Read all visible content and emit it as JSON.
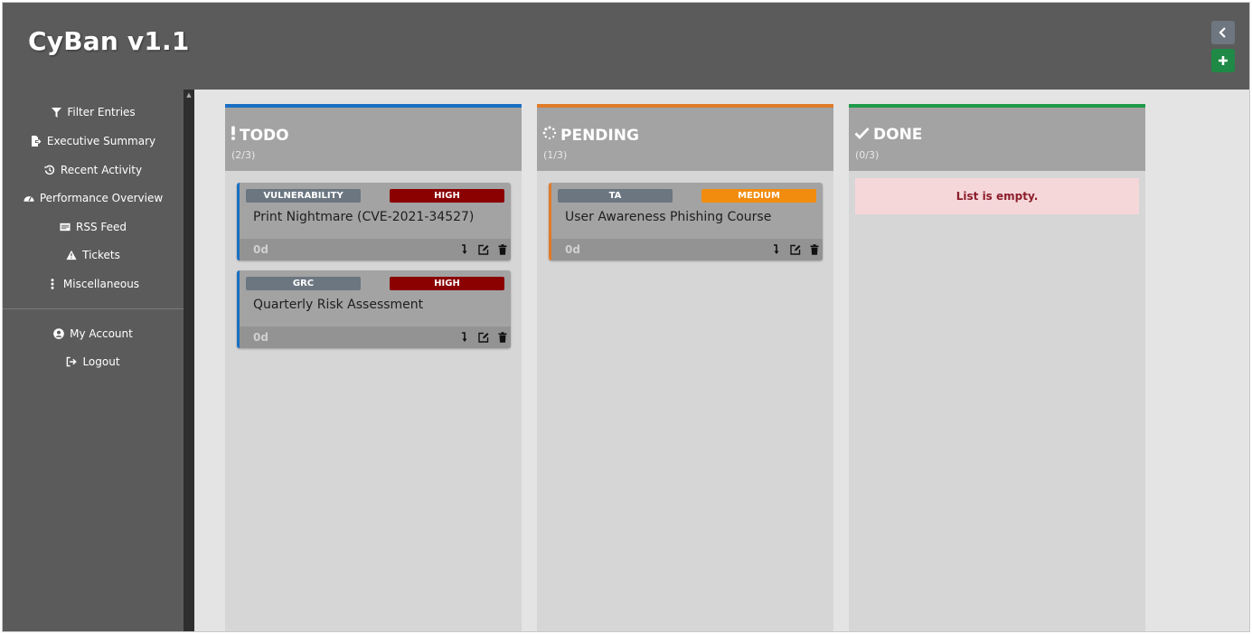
{
  "app": {
    "title": "CyBan v1.1"
  },
  "header_buttons": {
    "collapse": "‹",
    "add": "+"
  },
  "sidebar": {
    "items": [
      {
        "label": "Filter Entries",
        "icon": "filter-icon"
      },
      {
        "label": "Executive Summary",
        "icon": "export-file-icon"
      },
      {
        "label": "Recent Activity",
        "icon": "history-icon"
      },
      {
        "label": "Performance Overview",
        "icon": "tachometer-icon"
      },
      {
        "label": "RSS Feed",
        "icon": "newspaper-icon"
      },
      {
        "label": "Tickets",
        "icon": "warning-icon"
      },
      {
        "label": "Miscellaneous",
        "icon": "ellipsis-vertical-icon"
      }
    ],
    "account_items": [
      {
        "label": "My Account",
        "icon": "user-circle-icon"
      },
      {
        "label": "Logout",
        "icon": "sign-out-icon"
      }
    ]
  },
  "columns": [
    {
      "title": "TODO",
      "count": "(2/3)",
      "icon": "exclamation-icon",
      "accent": "#1a6fc4",
      "cards": [
        {
          "type": "VULNERABILITY",
          "priority": "HIGH",
          "priority_color": "#8b0000",
          "title": "Print Nightmare (CVE-2021-34527)",
          "age": "0d"
        },
        {
          "type": "GRC",
          "priority": "HIGH",
          "priority_color": "#8b0000",
          "title": "Quarterly Risk Assessment",
          "age": "0d"
        }
      ]
    },
    {
      "title": "PENDING",
      "count": "(1/3)",
      "icon": "spinner-icon",
      "accent": "#e07b2a",
      "cards": [
        {
          "type": "TA",
          "priority": "MEDIUM",
          "priority_color": "#f28c0f",
          "title": "User Awareness Phishing Course",
          "age": "0d"
        }
      ]
    },
    {
      "title": "DONE",
      "count": "(0/3)",
      "icon": "check-icon",
      "accent": "#1f9a4a",
      "cards": [],
      "empty_text": "List is empty."
    }
  ]
}
